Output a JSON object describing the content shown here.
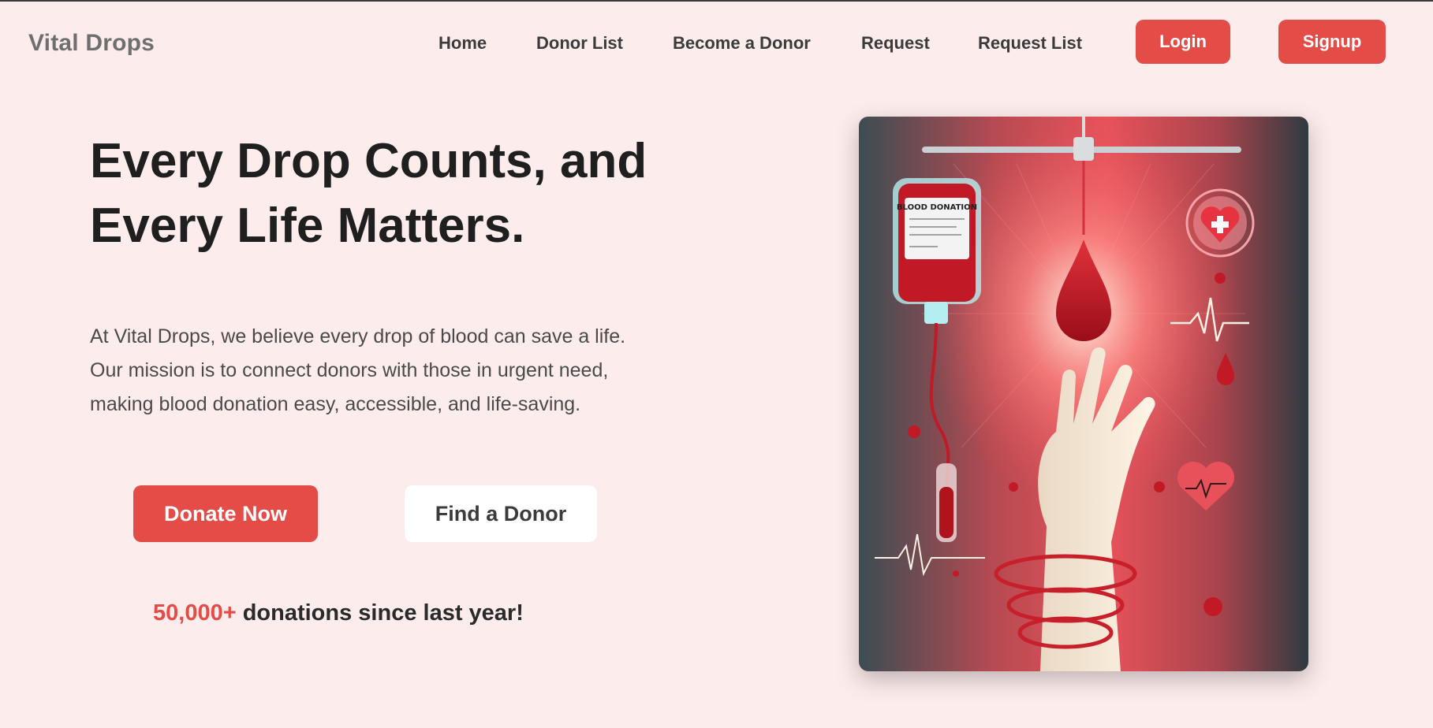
{
  "brand": {
    "name": "Vital Drops"
  },
  "nav": {
    "home": "Home",
    "donor_list": "Donor List",
    "become_donor": "Become a Donor",
    "request": "Request",
    "request_list": "Request List",
    "login": "Login",
    "signup": "Signup"
  },
  "hero": {
    "title_line1": "Every Drop Counts, and",
    "title_line2": "Every Life Matters.",
    "desc_line1": "At Vital Drops, we believe every drop of blood can save a life.",
    "desc_line2": "Our mission is to connect donors with those in urgent need,",
    "desc_line3": "making blood donation easy, accessible, and life-saving.",
    "donate_button": "Donate Now",
    "find_button": "Find a Donor",
    "stat_number": "50,000+",
    "stat_text": " donations since last year!",
    "image_bag_label": "BLOOD DONATION"
  },
  "colors": {
    "accent": "#e34c47",
    "background": "#fdecec",
    "text_dark": "#1f1f1f"
  }
}
